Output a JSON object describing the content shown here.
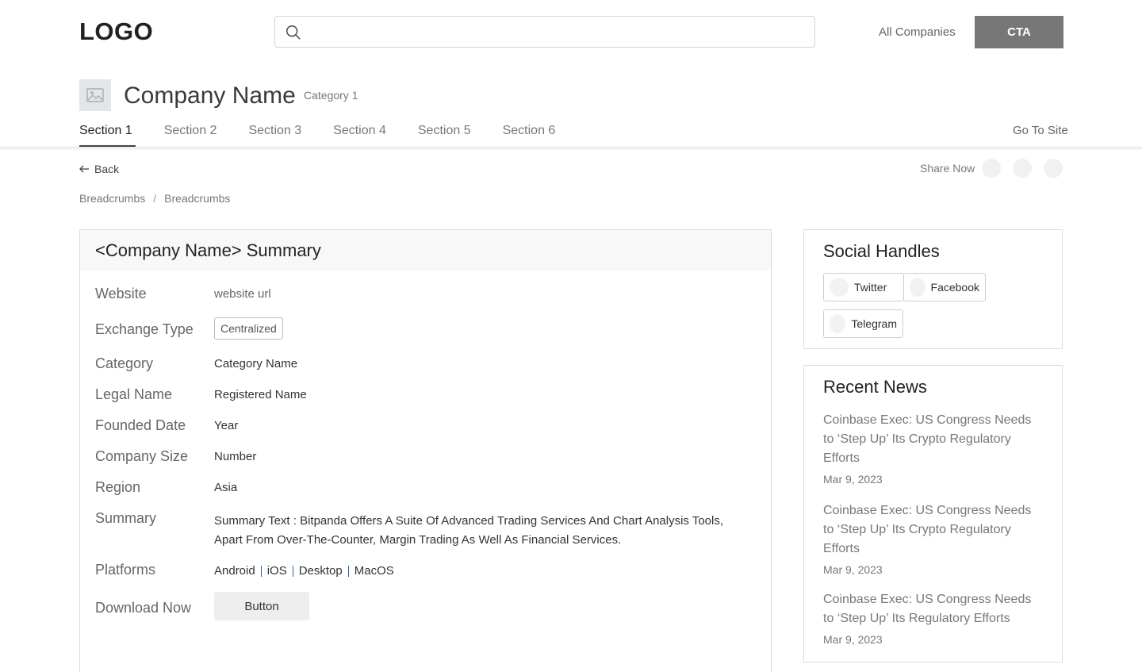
{
  "header": {
    "logo": "LOGO",
    "search_placeholder": "",
    "all_companies": "All Companies",
    "cta": "CTA"
  },
  "company": {
    "name": "Company Name",
    "category": "Category 1"
  },
  "tabs": [
    {
      "label": "Section 1",
      "active": true
    },
    {
      "label": "Section 2"
    },
    {
      "label": "Section 3"
    },
    {
      "label": "Section 4"
    },
    {
      "label": "Section 5"
    },
    {
      "label": "Section 6"
    }
  ],
  "go_to_site": "Go To Site",
  "back": "Back",
  "share_label": "Share Now",
  "breadcrumbs": [
    "Breadcrumbs",
    "Breadcrumbs"
  ],
  "summary": {
    "title": "<Company Name> Summary",
    "website_label": "Website",
    "website_value": "website url",
    "exchange_label": "Exchange Type",
    "exchange_value": "Centralized",
    "category_label": "Category",
    "category_value": "Category Name",
    "legal_label": "Legal Name",
    "legal_value": "Registered Name",
    "founded_label": "Founded Date",
    "founded_value": "Year",
    "size_label": "Company Size",
    "size_value": "Number",
    "region_label": "Region",
    "region_value": "Asia",
    "summary_label": "Summary",
    "summary_value": "Summary Text : Bitpanda Offers A Suite Of Advanced Trading Services And Chart Analysis Tools, Apart From Over-The-Counter, Margin Trading As Well As Financial Services.",
    "platforms_label": "Platforms",
    "platforms": [
      "Android",
      "iOS",
      "Desktop",
      "MacOS"
    ],
    "download_label": "Download Now",
    "download_button": "Button"
  },
  "social": {
    "title": "Social Handles",
    "handles": [
      "Twitter",
      "Facebook",
      "Telegram"
    ]
  },
  "news": {
    "title": "Recent News",
    "items": [
      {
        "title": "Coinbase Exec: US Congress Needs to ‘Step Up’ Its Crypto Regulatory Efforts",
        "date": "Mar 9, 2023"
      },
      {
        "title": "Coinbase Exec: US Congress Needs to ‘Step Up’ Its Crypto Regulatory Efforts",
        "date": "Mar 9, 2023"
      },
      {
        "title": "Coinbase Exec: US Congress Needs to ‘Step Up’ Its Regulatory Efforts",
        "date": "Mar 9, 2023"
      }
    ]
  },
  "colors": {
    "cta_bg": "#777777",
    "platform_divider": "#2a5db0"
  }
}
